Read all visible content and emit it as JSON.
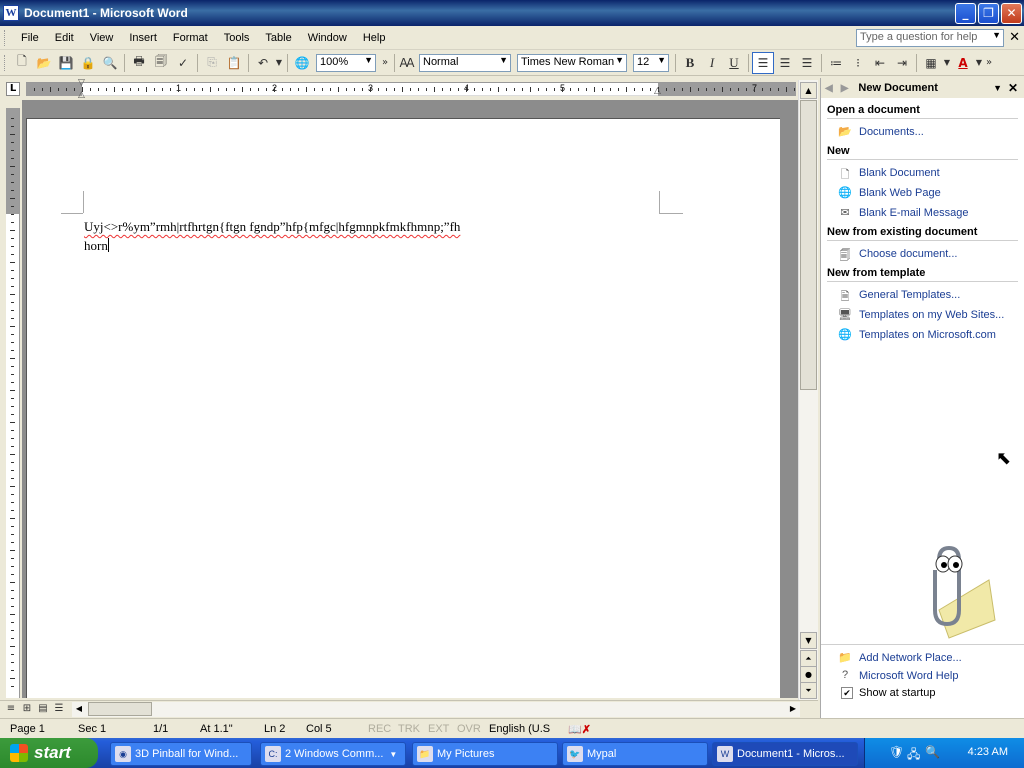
{
  "window": {
    "title": "Document1 - Microsoft Word",
    "app_icon_letter": "W"
  },
  "menu": {
    "items": [
      "File",
      "Edit",
      "View",
      "Insert",
      "Format",
      "Tools",
      "Table",
      "Window",
      "Help"
    ],
    "help_placeholder": "Type a question for help"
  },
  "toolbar": {
    "zoom": "100%",
    "style": "Normal",
    "font": "Times New Roman",
    "size": "12",
    "bold": "B",
    "italic": "I",
    "underline": "U",
    "font_color_letter": "A"
  },
  "ruler": {
    "numbers": [
      "1",
      "2",
      "3",
      "4",
      "5",
      "7"
    ]
  },
  "document": {
    "line1": "Uyj<>r%ym”rmh|rtfhrtgn{ftgn fgndp”hfp{mfgc|hfgmnpkfmkfhmnp;”fh",
    "line2": "horn"
  },
  "taskpane": {
    "title": "New Document",
    "sections": {
      "open": "Open a document",
      "new": "New",
      "existing": "New from existing document",
      "template": "New from template"
    },
    "links": {
      "documents": "Documents...",
      "blank_document": "Blank Document",
      "blank_web": "Blank Web Page",
      "blank_email": "Blank E-mail Message",
      "choose_document": "Choose document...",
      "general_templates": "General Templates...",
      "templates_web": "Templates on my Web Sites...",
      "templates_ms": "Templates on Microsoft.com",
      "add_network": "Add Network Place...",
      "word_help": "Microsoft Word Help"
    },
    "show_at_startup": "Show at startup"
  },
  "status": {
    "page": "Page 1",
    "sec": "Sec 1",
    "pages": "1/1",
    "at": "At 1.1\"",
    "ln": "Ln 2",
    "col": "Col 5",
    "rec": "REC",
    "trk": "TRK",
    "ext": "EXT",
    "ovr": "OVR",
    "lang": "English (U.S"
  },
  "taskbar": {
    "start": "start",
    "tasks": [
      "3D Pinball for Wind...",
      "2 Windows Comm...",
      "My Pictures",
      "Mypal",
      "Document1 - Micros..."
    ],
    "clock": "4:23 AM"
  }
}
